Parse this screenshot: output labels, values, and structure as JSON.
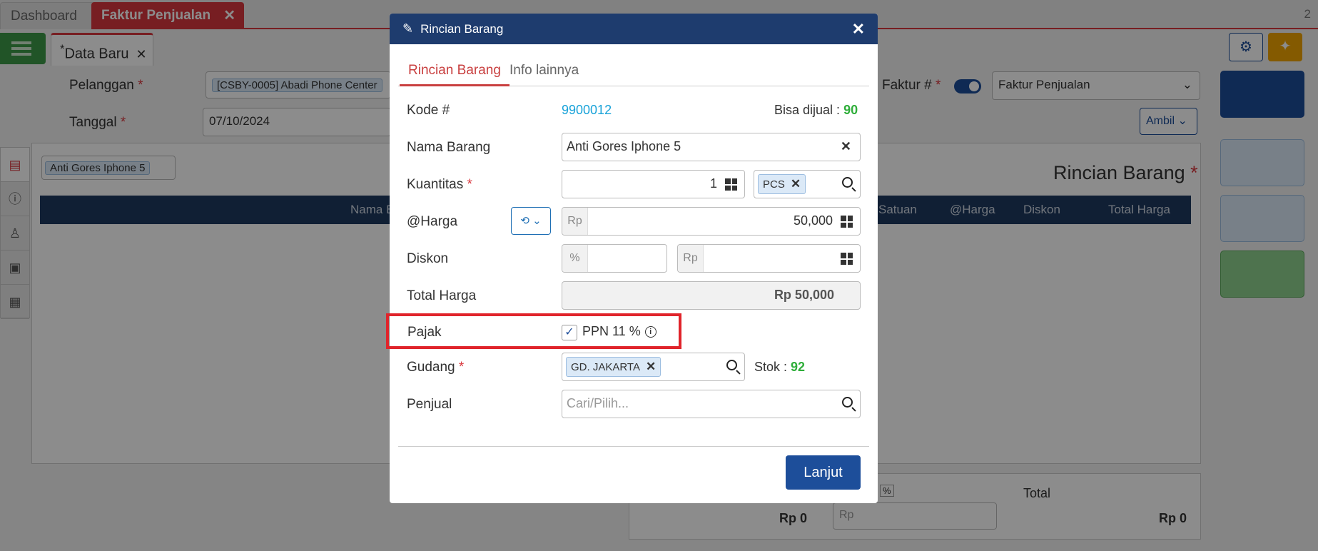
{
  "tabs": {
    "dashboard": "Dashboard",
    "faktur": "Faktur Penjualan",
    "close_glyph": "✕",
    "page_number": "2"
  },
  "subtab": {
    "label": "Data Baru",
    "modified_marker": "*"
  },
  "form": {
    "pelanggan_label": "Pelanggan",
    "pelanggan_value": "[CSBY-0005] Abadi Phone Center",
    "tanggal_label": "Tanggal",
    "tanggal_value": "07/10/2024",
    "faktur_label": "Faktur #",
    "faktur_type": "Faktur Penjualan",
    "ambil_label": "Ambil",
    "required_mark": "*"
  },
  "item_panel": {
    "chip": "Anti Gores Iphone 5",
    "title": "Rincian Barang",
    "columns": [
      "Nama B",
      "Satuan",
      "@Harga",
      "Diskon",
      "Total Harga"
    ]
  },
  "totals": {
    "subtotal": "Rp 0",
    "pct": "%",
    "rp_prefix": "Rp",
    "total_label": "Total",
    "total_value": "Rp 0"
  },
  "modal": {
    "title": "Rincian Barang",
    "tabs": [
      "Rincian Barang",
      "Info lainnya"
    ],
    "kode_label": "Kode #",
    "kode_value": "9900012",
    "bisa_dijual_label": "Bisa dijual :",
    "bisa_dijual_value": "90",
    "nama_label": "Nama Barang",
    "nama_value": "Anti Gores Iphone 5",
    "kuantitas_label": "Kuantitas",
    "kuantitas_value": "1",
    "satuan_chip": "PCS",
    "harga_label": "@Harga",
    "harga_prefix": "Rp",
    "harga_value": "50,000",
    "diskon_label": "Diskon",
    "diskon_pct_prefix": "%",
    "diskon_rp_prefix": "Rp",
    "total_label": "Total Harga",
    "total_value": "Rp 50,000",
    "pajak_label": "Pajak",
    "pajak_checked": true,
    "pajak_option": "PPN 11 %",
    "gudang_label": "Gudang",
    "gudang_chip": "GD. JAKARTA",
    "stok_label": "Stok :",
    "stok_value": "92",
    "penjual_label": "Penjual",
    "penjual_placeholder": "Cari/Pilih...",
    "lanjut_label": "Lanjut",
    "required_mark": "*"
  },
  "colors": {
    "header_navy": "#1e3c6e",
    "accent_red": "#d9383e",
    "link_blue": "#1aa3d9",
    "ok_green": "#2fae3a",
    "highlight_red": "#e0242b"
  }
}
